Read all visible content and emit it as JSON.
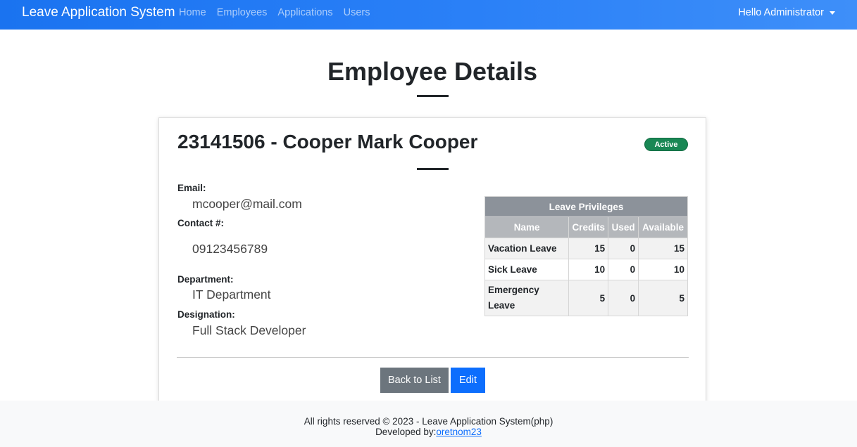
{
  "navbar": {
    "brand": "Leave Application System",
    "links": [
      "Home",
      "Employees",
      "Applications",
      "Users"
    ],
    "user_menu": "Hello Administrator"
  },
  "page": {
    "title": "Employee Details"
  },
  "employee": {
    "heading": "23141506 - Cooper Mark Cooper",
    "status": "Active",
    "fields": {
      "email_label": "Email:",
      "email": "mcooper@mail.com",
      "contact_label": "Contact #:",
      "contact": "09123456789",
      "department_label": "Department:",
      "department": "IT Department",
      "designation_label": "Designation:",
      "designation": "Full Stack Developer"
    }
  },
  "leave_privileges": {
    "caption": "Leave Privileges",
    "columns": [
      "Name",
      "Credits",
      "Used",
      "Available"
    ],
    "rows": [
      {
        "name": "Vacation Leave",
        "credits": "15",
        "used": "0",
        "available": "15"
      },
      {
        "name": "Sick Leave",
        "credits": "10",
        "used": "0",
        "available": "10"
      },
      {
        "name": "Emergency Leave",
        "credits": "5",
        "used": "0",
        "available": "5"
      }
    ]
  },
  "actions": {
    "back_label": "Back to List",
    "edit_label": "Edit"
  },
  "footer": {
    "rights": "All rights reserved © 2023 - Leave Application System(php)",
    "developed_by": "Developed by:",
    "developer_link": "oretnom23"
  },
  "colors": {
    "navbar": "#1a73f0",
    "status_badge": "#198754",
    "primary_button": "#0d6efd",
    "secondary_button": "#6c757d"
  }
}
